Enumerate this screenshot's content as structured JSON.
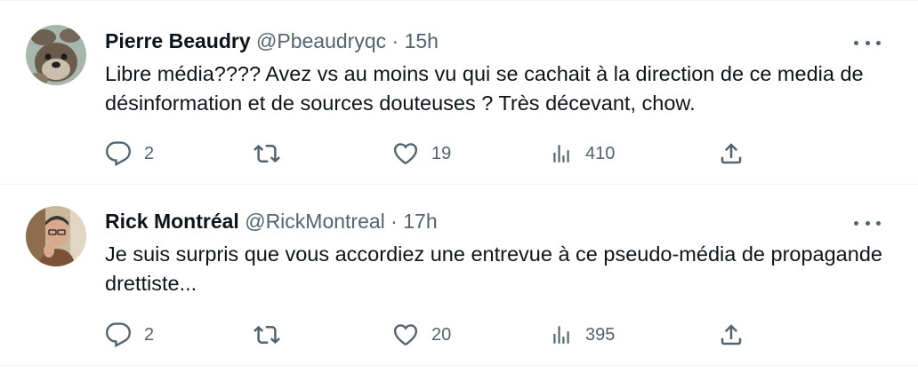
{
  "tweets": [
    {
      "name": "Pierre Beaudry",
      "handle": "@Pbeaudryqc",
      "separator": "·",
      "time": "15h",
      "text": "Libre média???? Avez vs au moins vu qui se cachait à  la direction de ce media de désinformation et de sources douteuses ? Très décevant, chow.",
      "replies": "2",
      "retweets": "",
      "likes": "19",
      "views": "410",
      "avatar": "otter-avatar"
    },
    {
      "name": "Rick Montréal",
      "handle": "@RickMontreal",
      "separator": "·",
      "time": "17h",
      "text": "Je suis surpris que vous accordiez une entrevue à ce pseudo-média de propagande drettiste...",
      "replies": "2",
      "retweets": "",
      "likes": "20",
      "views": "395",
      "avatar": "man-photo-avatar"
    }
  ],
  "colors": {
    "text": "#0f1419",
    "secondary": "#536471",
    "border": "#eff3f4"
  },
  "icons": [
    "reply-icon",
    "retweet-icon",
    "like-icon",
    "views-icon",
    "share-icon",
    "more-icon"
  ]
}
